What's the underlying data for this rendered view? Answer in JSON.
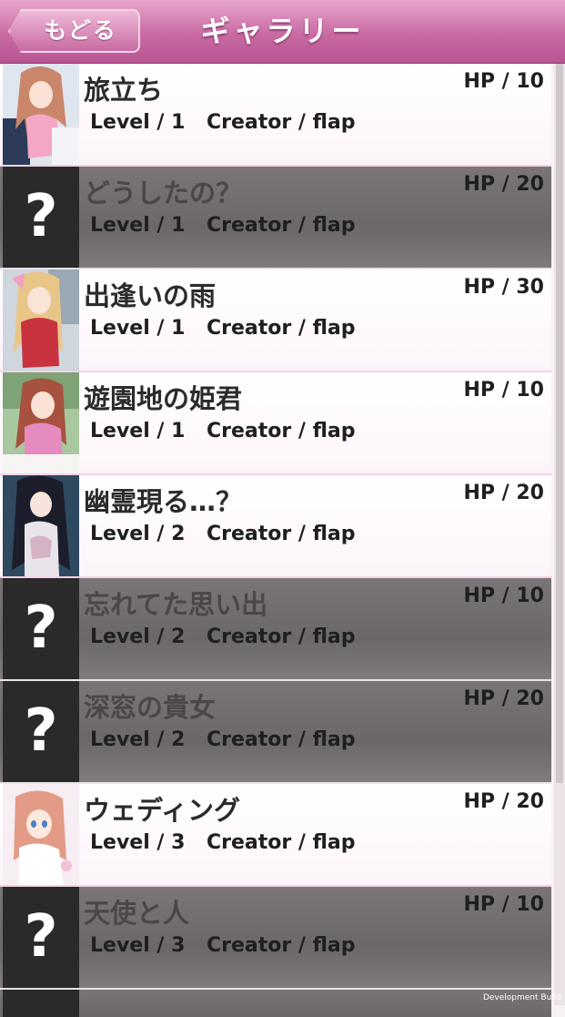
{
  "header": {
    "back_label": "もどる",
    "title": "ギャラリー"
  },
  "items": [
    {
      "title": "旅立ち",
      "hp": "HP / 10",
      "level": "Level / 1",
      "creator": "Creator / flap",
      "locked": false,
      "thumb": "girl-pink"
    },
    {
      "title": "どうしたの？",
      "hp": "HP / 20",
      "level": "Level / 1",
      "creator": "Creator / flap",
      "locked": true
    },
    {
      "title": "出逢いの雨",
      "hp": "HP / 30",
      "level": "Level / 1",
      "creator": "Creator / flap",
      "locked": false,
      "thumb": "girl-red"
    },
    {
      "title": "遊園地の姫君",
      "hp": "HP / 10",
      "level": "Level / 1",
      "creator": "Creator / flap",
      "locked": false,
      "thumb": "girl-green"
    },
    {
      "title": "幽霊現る…？",
      "hp": "HP / 20",
      "level": "Level / 2",
      "creator": "Creator / flap",
      "locked": false,
      "thumb": "girl-dark"
    },
    {
      "title": "忘れてた思い出",
      "hp": "HP / 10",
      "level": "Level / 2",
      "creator": "Creator / flap",
      "locked": true
    },
    {
      "title": "深窓の貴女",
      "hp": "HP / 20",
      "level": "Level / 2",
      "creator": "Creator / flap",
      "locked": true
    },
    {
      "title": "ウェディング",
      "hp": "HP / 20",
      "level": "Level / 3",
      "creator": "Creator / flap",
      "locked": false,
      "thumb": "girl-wedding"
    },
    {
      "title": "天使と人",
      "hp": "HP / 10",
      "level": "Level / 3",
      "creator": "Creator / flap",
      "locked": true
    }
  ],
  "locked_glyph": "?",
  "watermark": "Development Build"
}
